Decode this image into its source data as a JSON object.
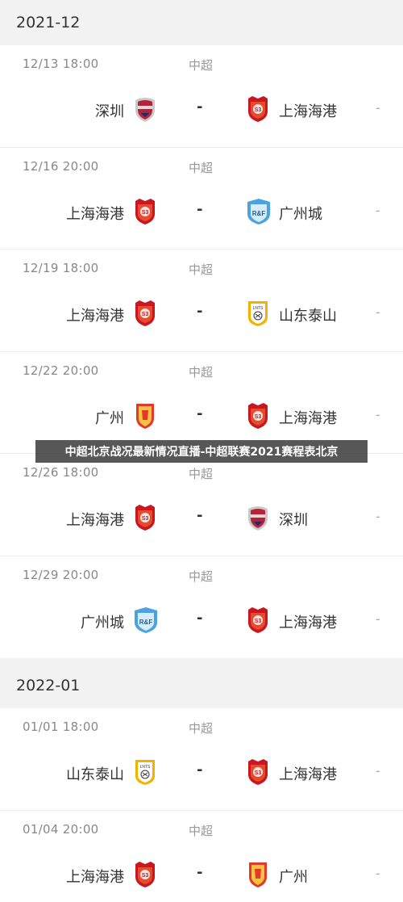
{
  "sections": [
    {
      "month": "2021-12",
      "matches": [
        {
          "date": "12/13  18:00",
          "league": "中超",
          "home": "深圳",
          "home_logo": "shenzhen-logo-icon",
          "vs": "-",
          "away": "上海海港",
          "away_logo": "shanghai-port-logo-icon",
          "score": "-"
        },
        {
          "date": "12/16  20:00",
          "league": "中超",
          "home": "上海海港",
          "home_logo": "shanghai-port-logo-icon",
          "vs": "-",
          "away": "广州城",
          "away_logo": "guangzhou-city-logo-icon",
          "score": "-"
        },
        {
          "date": "12/19  18:00",
          "league": "中超",
          "home": "上海海港",
          "home_logo": "shanghai-port-logo-icon",
          "vs": "-",
          "away": "山东泰山",
          "away_logo": "shandong-taishan-logo-icon",
          "score": "-"
        },
        {
          "date": "12/22  20:00",
          "league": "中超",
          "home": "广州",
          "home_logo": "guangzhou-logo-icon",
          "vs": "-",
          "away": "上海海港",
          "away_logo": "shanghai-port-logo-icon",
          "score": "-"
        },
        {
          "date": "12/26  18:00",
          "league": "中超",
          "home": "上海海港",
          "home_logo": "shanghai-port-logo-icon",
          "vs": "-",
          "away": "深圳",
          "away_logo": "shenzhen-logo-icon",
          "score": "-"
        },
        {
          "date": "12/29  20:00",
          "league": "中超",
          "home": "广州城",
          "home_logo": "guangzhou-city-logo-icon",
          "vs": "-",
          "away": "上海海港",
          "away_logo": "shanghai-port-logo-icon",
          "score": "-"
        }
      ]
    },
    {
      "month": "2022-01",
      "matches": [
        {
          "date": "01/01  18:00",
          "league": "中超",
          "home": "山东泰山",
          "home_logo": "shandong-taishan-logo-icon",
          "vs": "-",
          "away": "上海海港",
          "away_logo": "shanghai-port-logo-icon",
          "score": "-"
        },
        {
          "date": "01/04  20:00",
          "league": "中超",
          "home": "上海海港",
          "home_logo": "shanghai-port-logo-icon",
          "vs": "-",
          "away": "广州",
          "away_logo": "guangzhou-logo-icon",
          "score": "-"
        }
      ]
    }
  ],
  "overlay_caption": "中超北京战况最新情况直播-中超联赛2021赛程表北京",
  "colors": {
    "shanghai_port": "#c8171e",
    "guangzhou": "#e4382a",
    "guangzhou_city": "#4aa3df",
    "shandong": "#f2b300",
    "shenzhen": "#b3243a"
  }
}
